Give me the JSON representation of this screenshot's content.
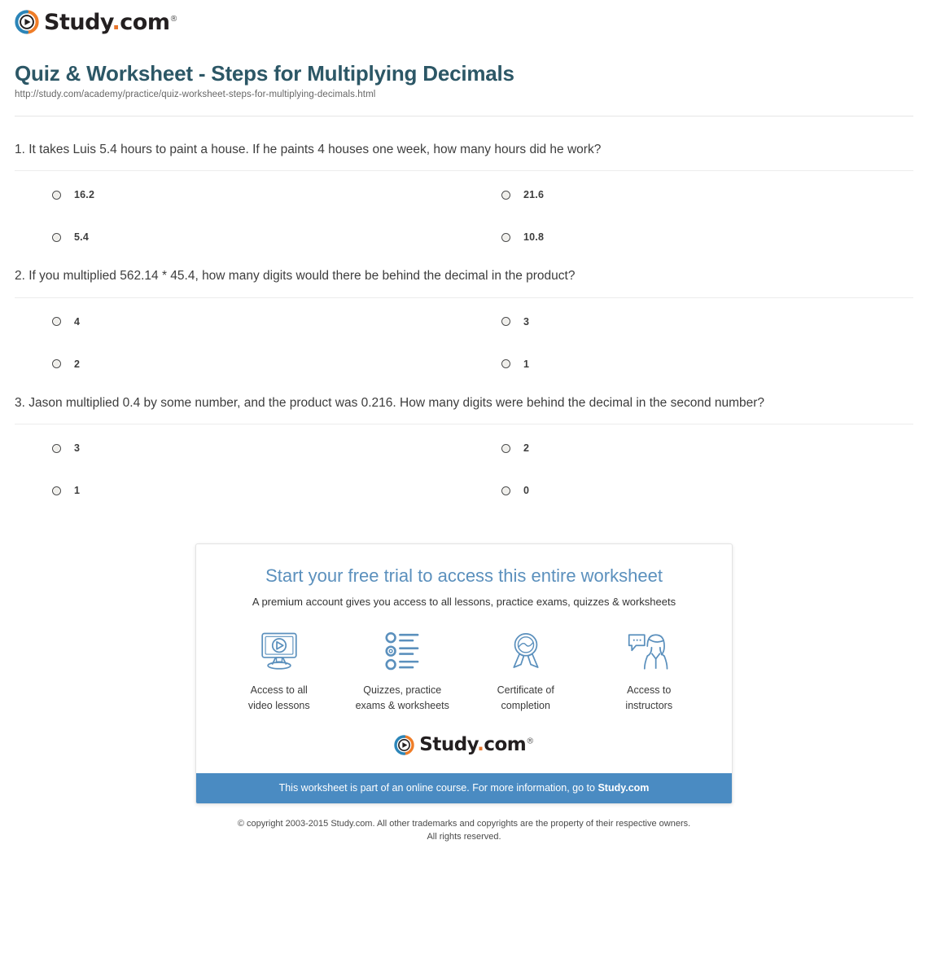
{
  "brand": {
    "name_main": "Study",
    "name_dot": ".",
    "name_tld": "com",
    "trademark": "®",
    "logo_icon": "play-circle-icon",
    "ring_blue": "#2b85b8",
    "ring_orange": "#ef7d28",
    "wordmark_color": "#231f20"
  },
  "header": {
    "title": "Quiz & Worksheet - Steps for Multiplying Decimals",
    "url": "http://study.com/academy/practice/quiz-worksheet-steps-for-multiplying-decimals.html",
    "title_color": "#2c5766"
  },
  "questions": [
    {
      "text": "1. It takes Luis 5.4 hours to paint a house. If he paints 4 houses one week, how many hours did he work?",
      "options": [
        "16.2",
        "21.6",
        "5.4",
        "10.8"
      ]
    },
    {
      "text": "2. If you multiplied 562.14 * 45.4, how many digits would there be behind the decimal in the product?",
      "options": [
        "4",
        "3",
        "2",
        "1"
      ]
    },
    {
      "text": "3. Jason multiplied 0.4 by some number, and the product was 0.216. How many digits were behind the decimal in the second number?",
      "options": [
        "3",
        "2",
        "1",
        "0"
      ]
    }
  ],
  "promo": {
    "headline": "Start your free trial to access this entire worksheet",
    "headline_color": "#5b90bd",
    "subtext": "A premium account gives you access to all lessons, practice exams, quizzes & worksheets",
    "features": [
      {
        "icon": "monitor-play-icon",
        "line1": "Access to all",
        "line2": "video lessons"
      },
      {
        "icon": "checklist-icon",
        "line1": "Quizzes, practice",
        "line2": "exams & worksheets"
      },
      {
        "icon": "award-ribbon-icon",
        "line1": "Certificate of",
        "line2": "completion"
      },
      {
        "icon": "instructor-chat-icon",
        "line1": "Access to",
        "line2": "instructors"
      }
    ],
    "bar_text_prefix": "This worksheet is part of an online course. For more information, go to ",
    "bar_link_text": "Study.com",
    "bar_color": "#4a8bc2"
  },
  "footer": {
    "copyright_line1": "© copyright 2003-2015 Study.com. All other trademarks and copyrights are the property of their respective owners.",
    "copyright_line2": "All rights reserved."
  }
}
